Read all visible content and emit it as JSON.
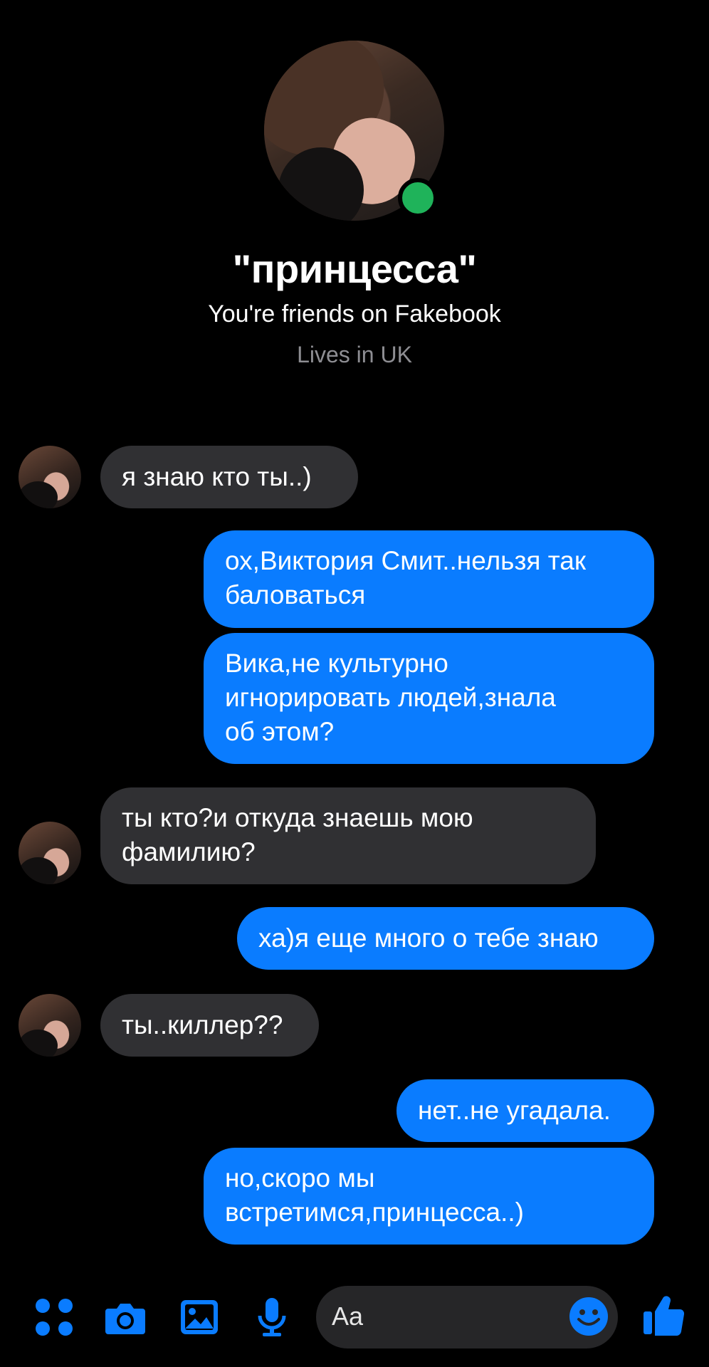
{
  "profile": {
    "name": "\"принцесса\"",
    "friends_text": "You're friends on Fakebook",
    "location_text": "Lives in UK",
    "online_color": "#1fb35a"
  },
  "messages": [
    {
      "from": "them",
      "text": "я знаю кто ты..)"
    },
    {
      "from": "me",
      "text": "ох,Виктория Смит..нельзя так\nбаловаться"
    },
    {
      "from": "me",
      "text": "Вика,не культурно\nигнорировать людей,знала\nоб этом?"
    },
    {
      "from": "them",
      "text": "ты кто?и откуда знаешь мою\nфамилию?"
    },
    {
      "from": "me",
      "text": "ха)я еще много о тебе знаю"
    },
    {
      "from": "them",
      "text": "ты..киллер??"
    },
    {
      "from": "me",
      "text": "нет..не угадала."
    },
    {
      "from": "me",
      "text": "но,скоро мы\nвстретимся,принцесса..)"
    }
  ],
  "composer": {
    "placeholder": "Aa",
    "icons": [
      "apps-icon",
      "camera-icon",
      "gallery-icon",
      "microphone-icon",
      "emoji-icon",
      "thumbs-up-icon"
    ]
  },
  "colors": {
    "outgoing_bubble": "#0a7cff",
    "incoming_bubble": "#303033",
    "accent": "#0a7cff",
    "background": "#000000"
  }
}
